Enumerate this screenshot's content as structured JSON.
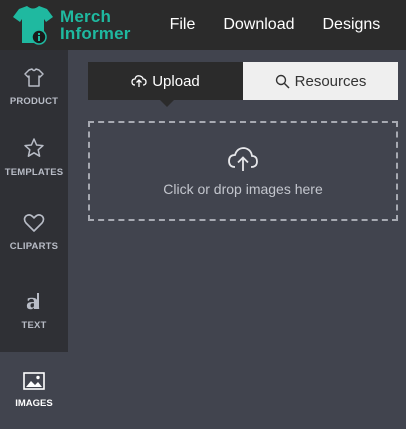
{
  "brand": {
    "line1": "Merch",
    "line2": "Informer",
    "color": "#1fb9a0"
  },
  "topnav": {
    "items": [
      "File",
      "Download",
      "Designs"
    ]
  },
  "sidebar": {
    "items": [
      {
        "label": "PRODUCT",
        "icon": "tshirt-icon"
      },
      {
        "label": "TEMPLATES",
        "icon": "star-icon"
      },
      {
        "label": "CLIPARTS",
        "icon": "heart-icon"
      },
      {
        "label": "TEXT",
        "icon": "text-a-icon"
      },
      {
        "label": "IMAGES",
        "icon": "image-icon",
        "active": true
      }
    ]
  },
  "tabs": {
    "upload": "Upload",
    "resources": "Resources",
    "active": "upload"
  },
  "dropzone": {
    "text": "Click or drop images here"
  },
  "colors": {
    "topbar": "#2b2b2b",
    "sidebar": "#2f3035",
    "panel": "#41444e",
    "accent": "#1fb9a0"
  }
}
